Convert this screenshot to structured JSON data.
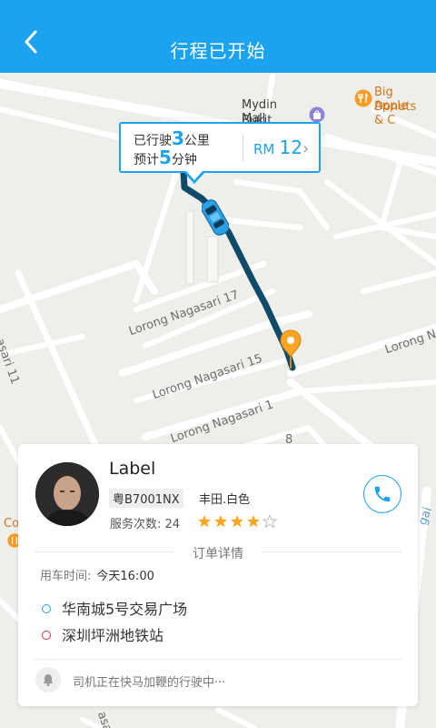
{
  "header": {
    "title": "行程已开始",
    "background": "#1ba3f0"
  },
  "map": {
    "poi": {
      "mydin": [
        "Mydin Mall",
        "Bukit Mertajam"
      ],
      "big_apple": [
        "Big Apple",
        "Donuts & C"
      ]
    },
    "streets": {
      "nagasari_17": "Lorong Nagasari 17",
      "nagasari_15": "Lorong Nagasari 15",
      "nagasari_1": "Lorong Nagasari 1",
      "nagasari_right": "Lorong Nagas",
      "left_11": "asari 11",
      "left_co": "Co",
      "partial_8": "8",
      "partial_right": "gai",
      "partial_bottom": "asa"
    },
    "route_color": "#0f4a6a"
  },
  "trip_bubble": {
    "distance_prefix": "已行驶",
    "distance_value": "3",
    "distance_unit": "公里",
    "eta_prefix": "预计",
    "eta_value": "5",
    "eta_unit": "分钟",
    "currency": "RM",
    "price": "12",
    "chevron": "›"
  },
  "driver_card": {
    "name": "Label",
    "plate": "粤B7001NX",
    "car": "丰田.白色",
    "service_count_label": "服务次数:",
    "service_count": "24",
    "rating": 4,
    "rating_max": 5,
    "phone_icon": "phone-icon",
    "order_details_label": "订单详情",
    "time_label": "用车时间:",
    "time_value": "今天16:00",
    "pickup": "华南城5号交易广场",
    "pickup_color": "#1ba3f0",
    "dropoff": "深圳坪洲地铁站",
    "dropoff_color": "#d9363e",
    "status_icon": "bell-icon",
    "status": "司机正在快马加鞭的行驶中···"
  }
}
